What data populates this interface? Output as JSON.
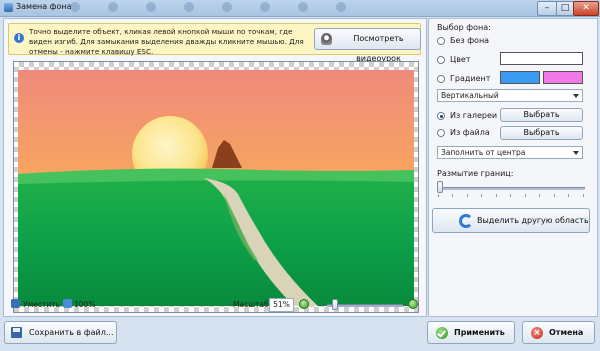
{
  "window": {
    "title": "Замена фона",
    "minimize_glyph": "–",
    "maximize_glyph": "□",
    "close_glyph": "✕"
  },
  "hint": {
    "text": "Точно выделите объект, кликая левой кнопкой мыши по точкам, где виден изгиб. Для замыкания выделения дважды кликните мышью. Для отмены - нажмите клавишу ESC.",
    "icon": "info-icon",
    "video_button_label": "Посмотреть видеоурок"
  },
  "status_bar": {
    "fit_label": "Уместить",
    "zoom_100_label": "100%",
    "scale_label": "Масштаб:",
    "scale_value": "51%",
    "zoom_slider_fraction": 0.06
  },
  "background_panel": {
    "title": "Выбор фона:",
    "options": [
      {
        "label": "Без фона",
        "checked": false
      },
      {
        "label": "Цвет",
        "checked": false
      },
      {
        "label": "Градиент",
        "checked": false
      },
      {
        "label": "Из галереи",
        "checked": true
      },
      {
        "label": "Из файла",
        "checked": false
      }
    ],
    "gradient_colors": [
      "#3a9bf0",
      "#f27ae8"
    ],
    "gradient_direction": "Вертикальный",
    "gallery_choose_label": "Выбрать",
    "file_choose_label": "Выбрать",
    "fill_mode": "Заполнить от центра",
    "blur_label": "Размытие границ:",
    "blur_fraction": 0.0,
    "select_area_label": "Выделить другую область"
  },
  "footer": {
    "save_label": "Сохранить в файл...",
    "apply_label": "Применить",
    "cancel_label": "Отмена"
  },
  "colors": {
    "accent_blue": "#2f79d1",
    "hint_background": "#fdf6c4",
    "apply_green": "#2a8d1c",
    "cancel_red": "#c42716"
  }
}
